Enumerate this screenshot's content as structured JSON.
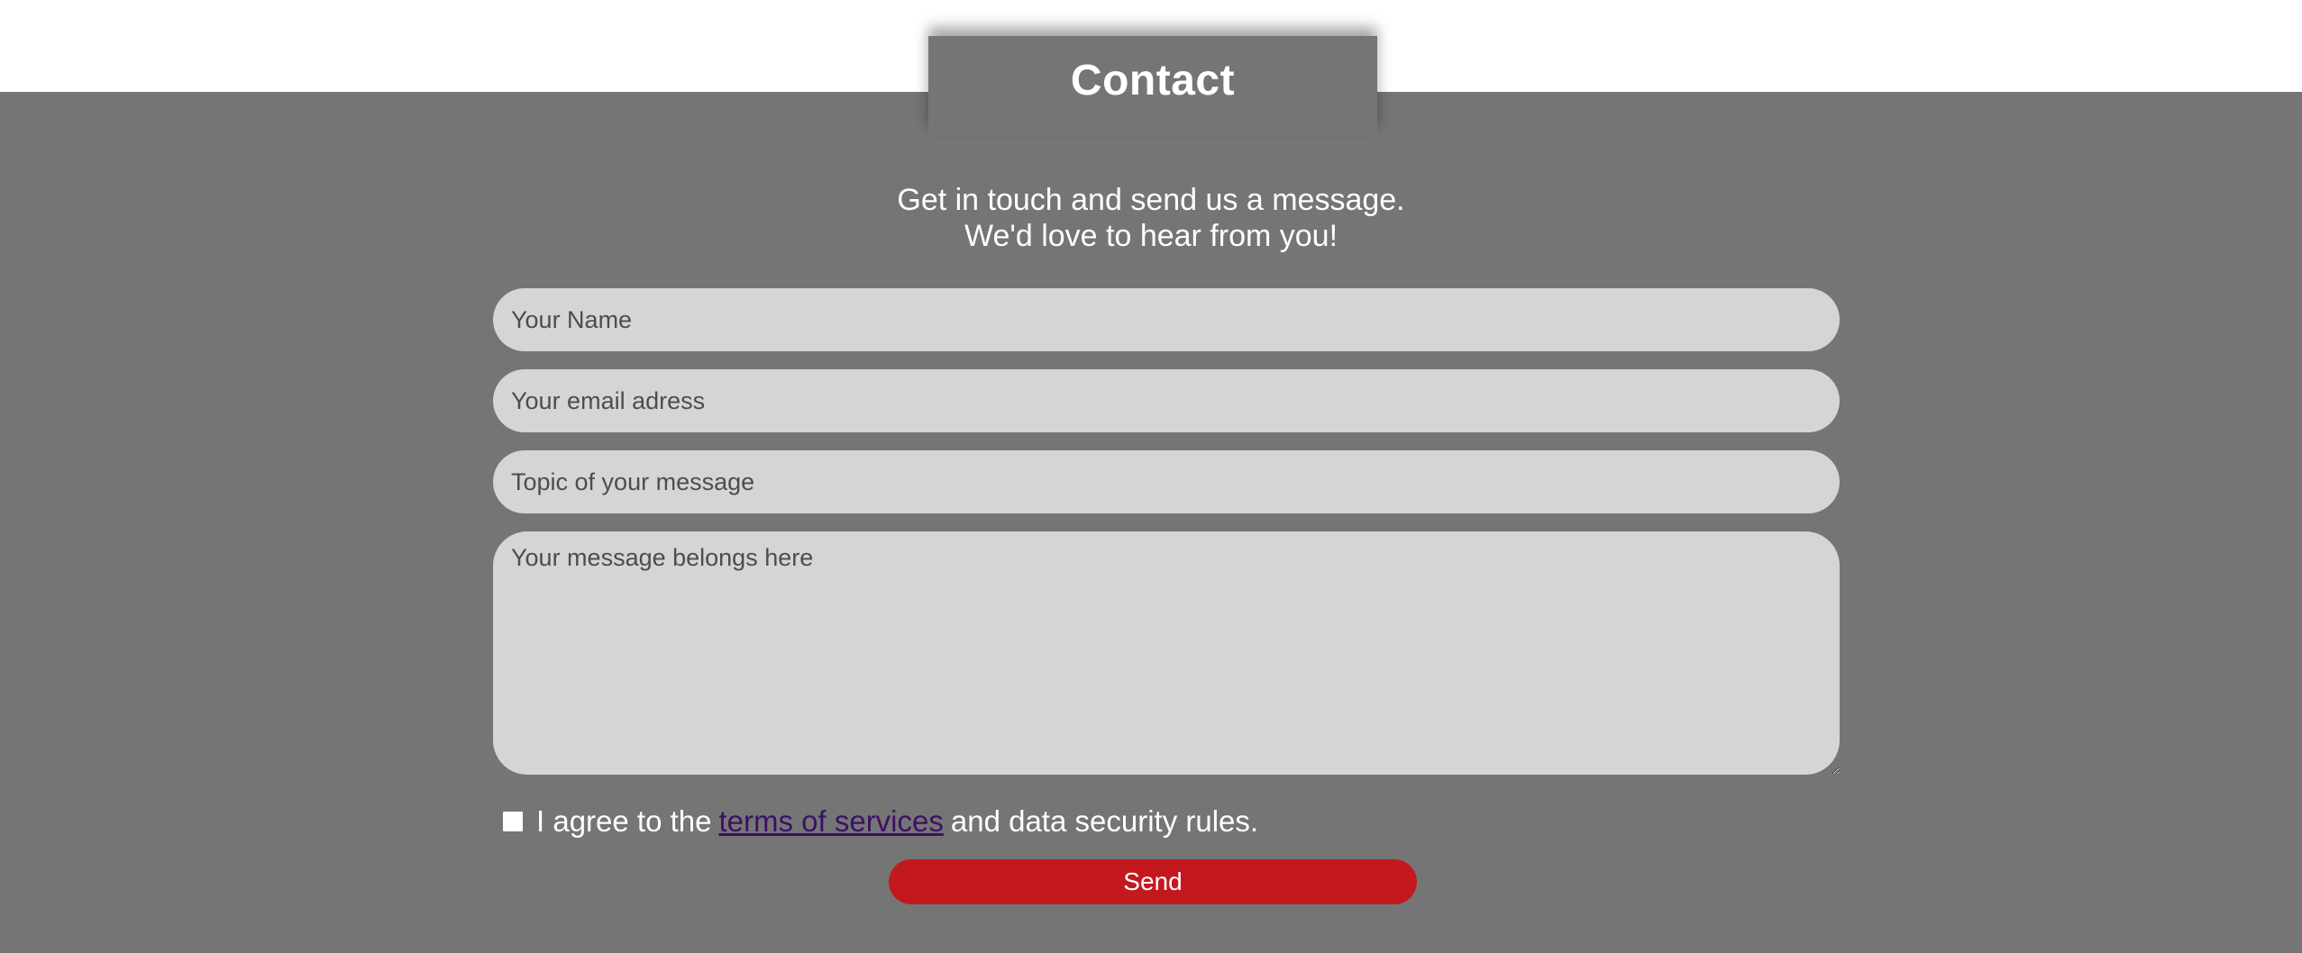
{
  "contact": {
    "title": "Contact",
    "intro_line1": "Get in touch and send us a message.",
    "intro_line2": "We'd love to hear from you!"
  },
  "form": {
    "name_placeholder": "Your Name",
    "email_placeholder": "Your email adress",
    "topic_placeholder": "Topic of your message",
    "message_placeholder": "Your message belongs here",
    "agree_prefix": "I agree to the",
    "terms_link": "terms of services",
    "agree_suffix": "and data security rules.",
    "send_label": "Send"
  },
  "colors": {
    "section_bg": "#757575",
    "field_bg": "#d5d5d5",
    "send_button": "#c4181f",
    "link": "#3b1167"
  }
}
